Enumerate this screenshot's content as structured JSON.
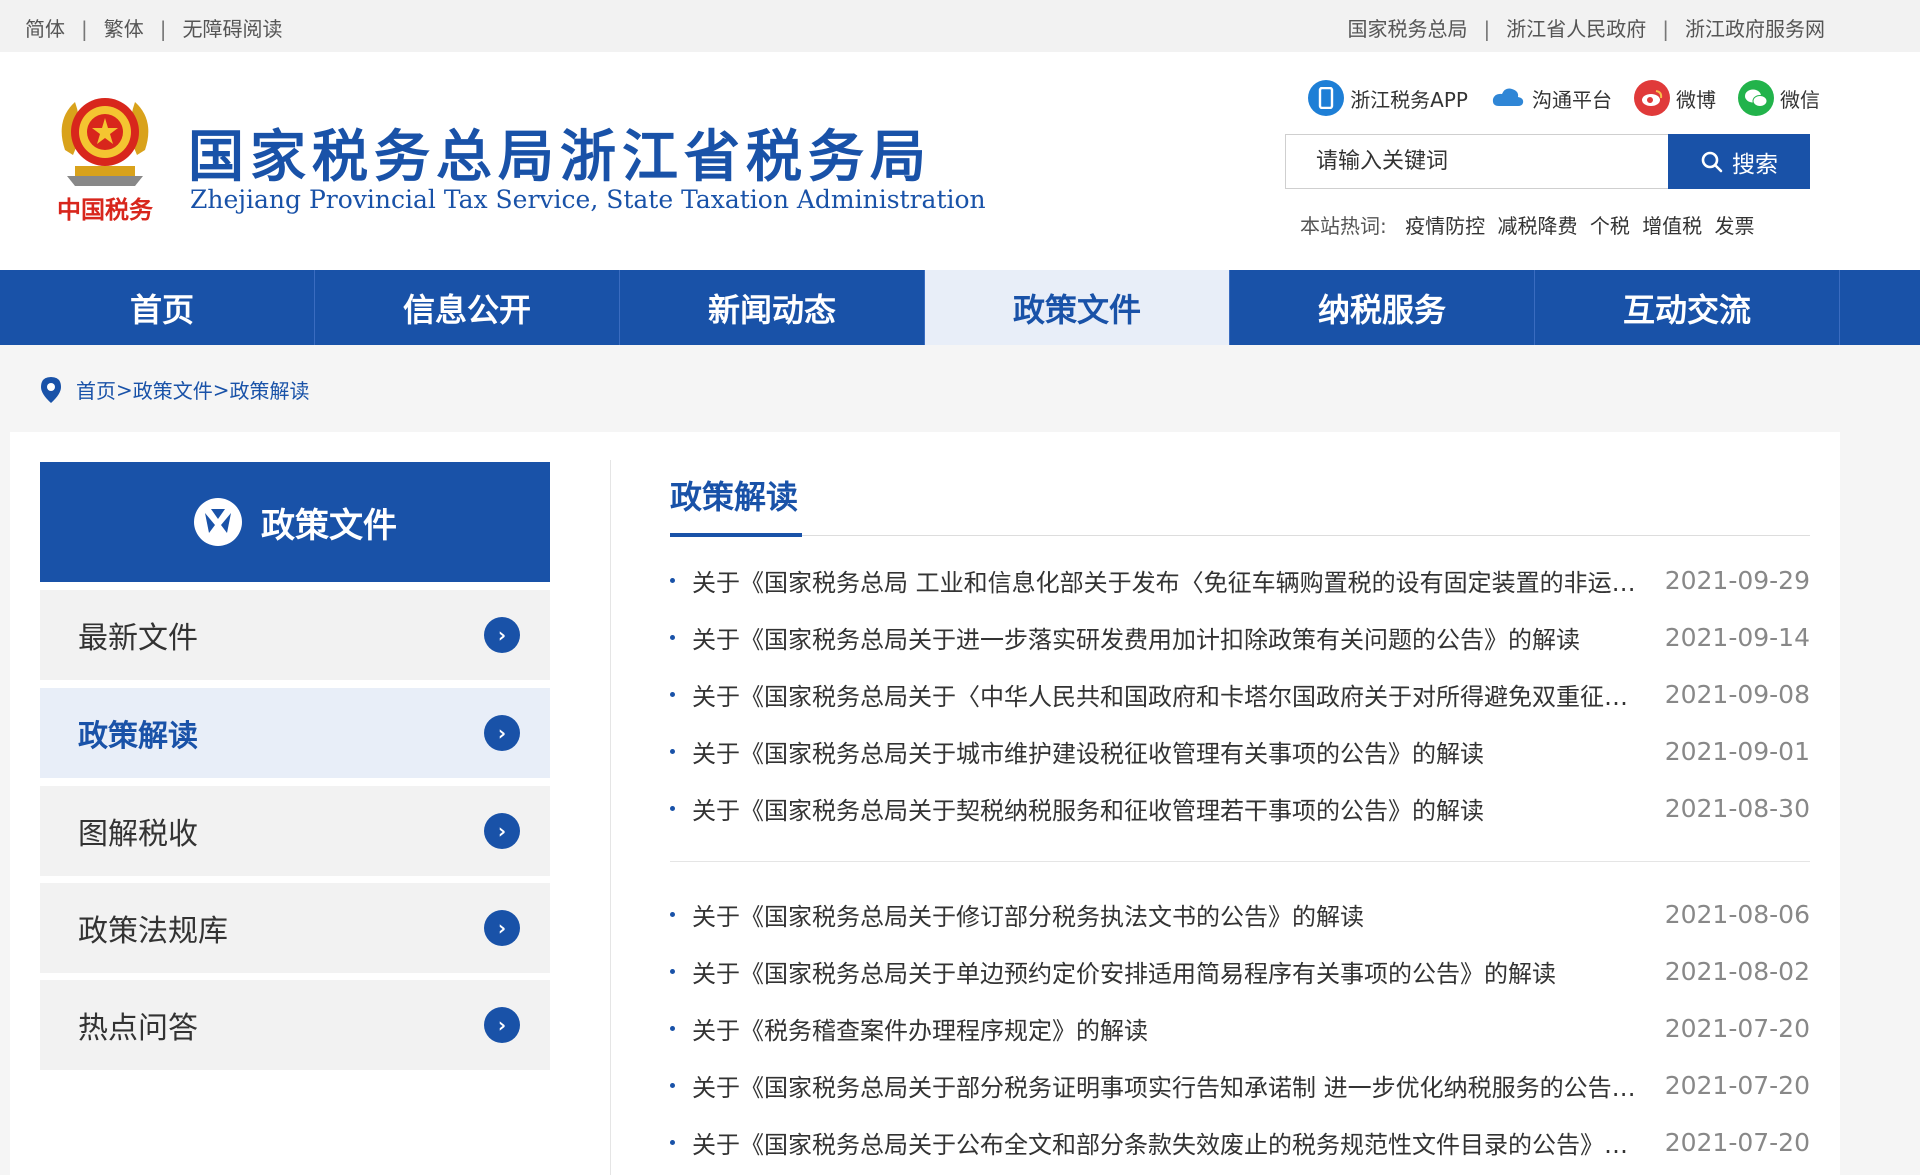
{
  "topbar": {
    "left": [
      "简体",
      "繁体",
      "无障碍阅读"
    ],
    "right": [
      "国家税务总局",
      "浙江省人民政府",
      "浙江政府服务网"
    ]
  },
  "header": {
    "emblem_icon": "national-tax-emblem-icon",
    "emblem_text": "中国税务",
    "title": "国家税务总局浙江省税务局",
    "subtitle": "Zhejiang Provincial Tax Service, State Taxation Administration"
  },
  "social": [
    {
      "label": "浙江税务APP",
      "icon": "phone-app-icon"
    },
    {
      "label": "沟通平台",
      "icon": "cloud-icon"
    },
    {
      "label": "微博",
      "icon": "weibo-icon"
    },
    {
      "label": "微信",
      "icon": "wechat-icon"
    }
  ],
  "search": {
    "placeholder": "请输入关键词",
    "button": "搜索"
  },
  "hot": {
    "label": "本站热词:",
    "words": [
      "疫情防控",
      "减税降费",
      "个税",
      "增值税",
      "发票"
    ]
  },
  "nav": [
    "首页",
    "信息公开",
    "新闻动态",
    "政策文件",
    "纳税服务",
    "互动交流"
  ],
  "nav_active": 3,
  "breadcrumb": [
    "首页",
    "政策文件",
    "政策解读"
  ],
  "sidebar": {
    "title": "政策文件",
    "items": [
      "最新文件",
      "政策解读",
      "图解税收",
      "政策法规库",
      "热点问答"
    ],
    "active": 1
  },
  "content": {
    "title": "政策解读",
    "group1": [
      {
        "title": "关于《国家税务总局 工业和信息化部关于发布〈免征车辆购置税的设有固定装置的非运输专用作业车辆目录〉的公告》的解读",
        "date": "2021-09-29"
      },
      {
        "title": "关于《国家税务总局关于进一步落实研发费用加计扣除政策有关问题的公告》的解读",
        "date": "2021-09-14"
      },
      {
        "title": "关于《国家税务总局关于〈中华人民共和国政府和卡塔尔国政府关于对所得避免双重征税和防止偷漏税的协定〉生效执行的公告》的解读",
        "date": "2021-09-08"
      },
      {
        "title": "关于《国家税务总局关于城市维护建设税征收管理有关事项的公告》的解读",
        "date": "2021-09-01"
      },
      {
        "title": "关于《国家税务总局关于契税纳税服务和征收管理若干事项的公告》的解读",
        "date": "2021-08-30"
      }
    ],
    "group2": [
      {
        "title": "关于《国家税务总局关于修订部分税务执法文书的公告》的解读",
        "date": "2021-08-06"
      },
      {
        "title": "关于《国家税务总局关于单边预约定价安排适用简易程序有关事项的公告》的解读",
        "date": "2021-08-02"
      },
      {
        "title": "关于《税务稽查案件办理程序规定》的解读",
        "date": "2021-07-20"
      },
      {
        "title": "关于《国家税务总局关于部分税务证明事项实行告知承诺制 进一步优化纳税服务的公告》的解读",
        "date": "2021-07-20"
      },
      {
        "title": "关于《国家税务总局关于公布全文和部分条款失效废止的税务规范性文件目录的公告》的解读",
        "date": "2021-07-20"
      }
    ]
  }
}
